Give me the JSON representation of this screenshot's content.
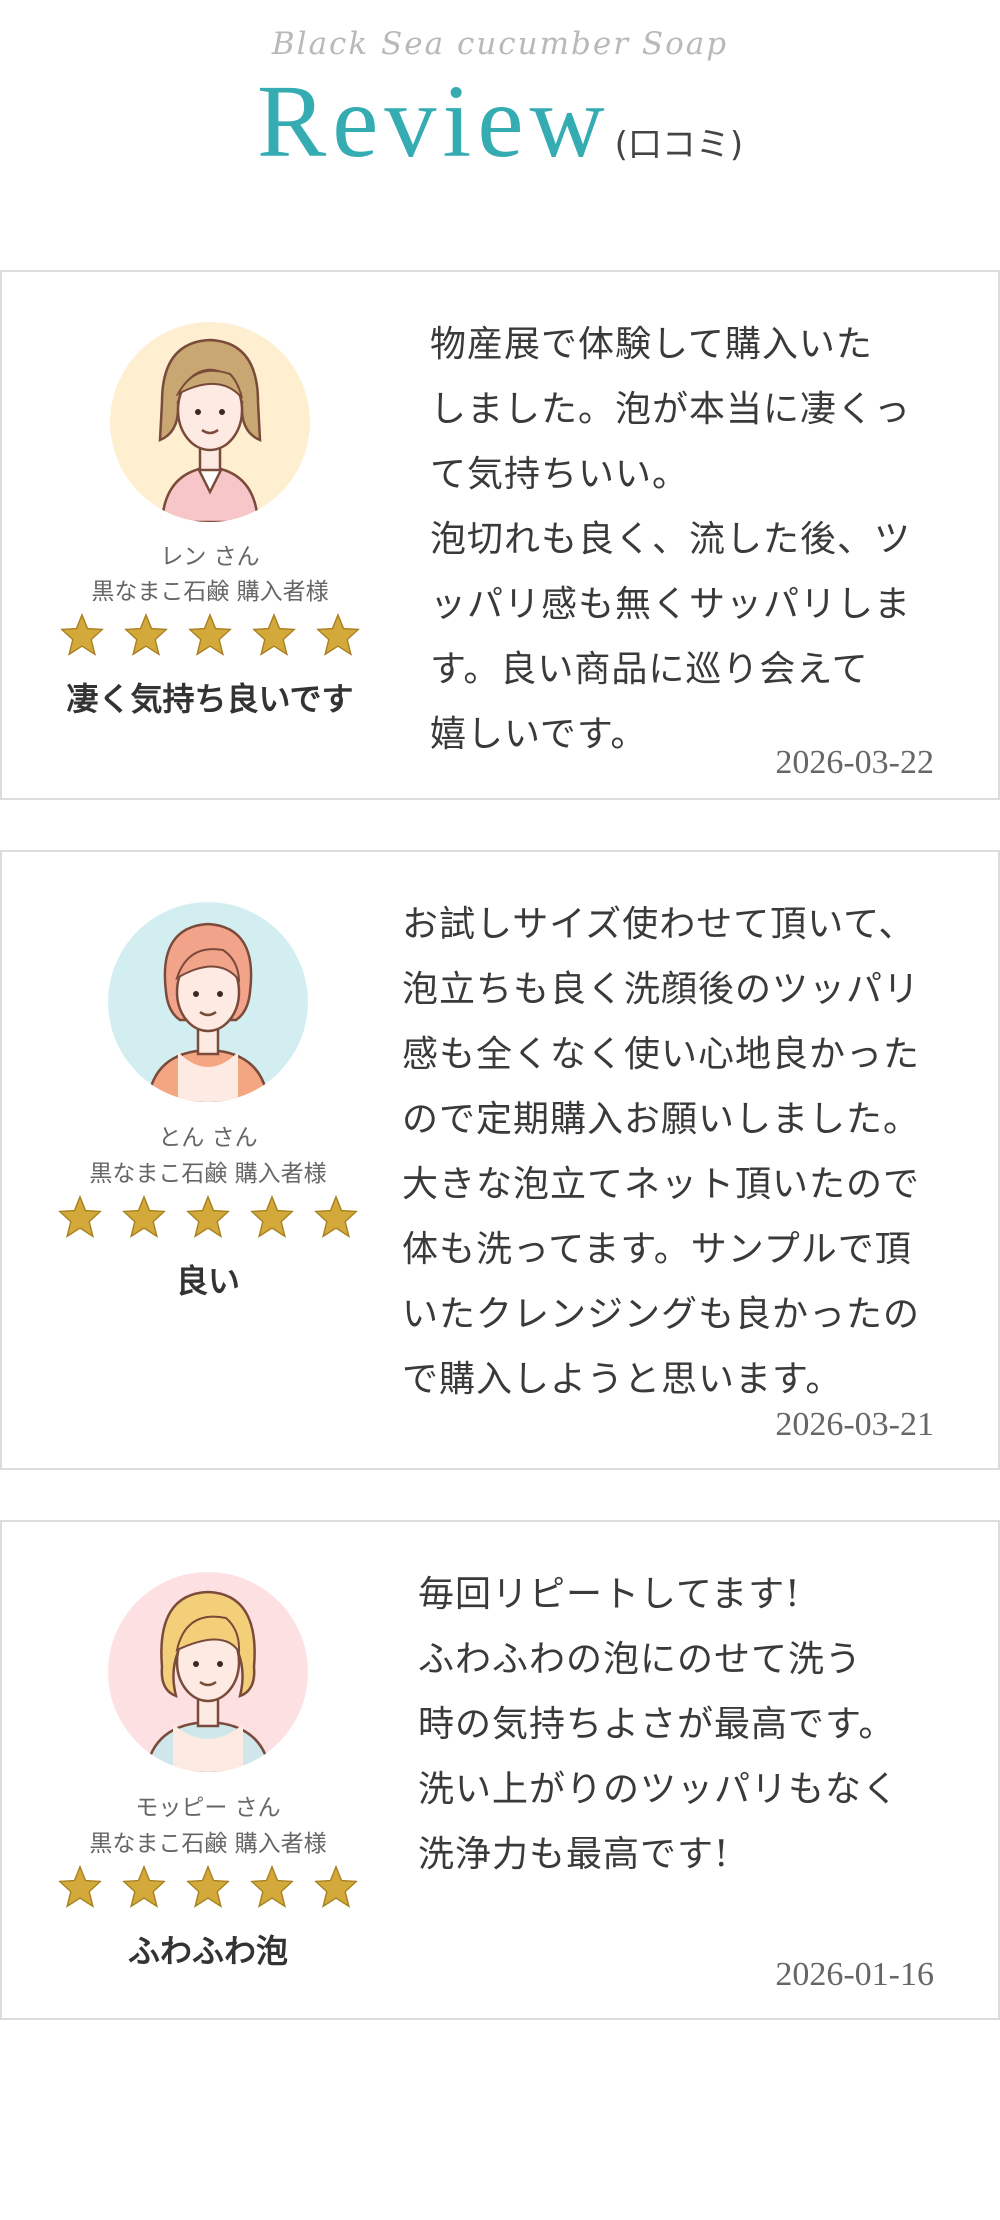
{
  "header": {
    "subtitle": "Black Sea cucumber Soap",
    "title": "Review",
    "title_sub": "(口コミ)"
  },
  "colors": {
    "accent": "#35acb2",
    "star": "#d4a93c",
    "border": "#dcdcdc"
  },
  "reviews": [
    {
      "reviewer": "レン さん",
      "product": "黒なまこ石鹸 購入者様",
      "rating": 5,
      "headline": "凄く気持ち良いです",
      "body": "物産展で体験して購入いた\nしました。泡が本当に凄くっ\nて気持ちいい。\n泡切れも良く、流した後、ツ\nッパリ感も無くサッパリしま\nす。良い商品に巡り会えて\n嬉しいです。",
      "date": "2026-03-22",
      "avatar_icon": "woman-avatar-icon",
      "avatar_bg": "#fdefd0"
    },
    {
      "reviewer": "とん さん",
      "product": "黒なまこ石鹸 購入者様",
      "rating": 5,
      "headline": "良い",
      "body": "お試しサイズ使わせて頂いて、\n泡立ちも良く洗顔後のツッパリ\n感も全くなく使い心地良かった\nので定期購入お願いしました。\n大きな泡立てネット頂いたので\n体も洗ってます。サンプルで頂\nいたクレンジングも良かったの\nで購入しようと思います。",
      "date": "2026-03-21",
      "avatar_icon": "woman-avatar-icon",
      "avatar_bg": "#d3eef0"
    },
    {
      "reviewer": "モッピー さん",
      "product": "黒なまこ石鹸 購入者様",
      "rating": 5,
      "headline": "ふわふわ泡",
      "body": "毎回リピートしてます!\nふわふわの泡にのせて洗う\n時の気持ちよさが最高です。\n洗い上がりのツッパリもなく\n洗浄力も最高です!",
      "date": "2026-01-16",
      "avatar_icon": "woman-avatar-icon",
      "avatar_bg": "#fde0e2"
    }
  ]
}
